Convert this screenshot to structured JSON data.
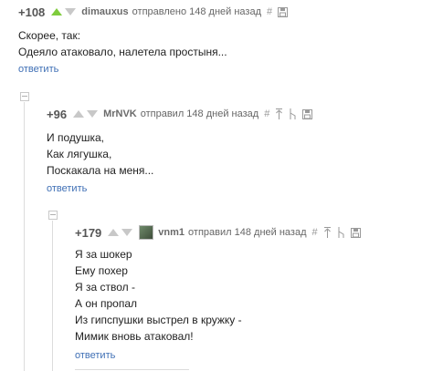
{
  "comments": [
    {
      "rating": "+108",
      "author": "dimauxus",
      "meta": "отправлено 148 дней назад",
      "lines": [
        "Скорее, так:",
        "Одеяло атаковало, налетела простыня..."
      ],
      "reply_label": "ответить",
      "tools": [
        "link-hash-icon",
        "save-icon"
      ]
    },
    {
      "rating": "+96",
      "author": "MrNVK",
      "meta": "отправил 148 дней назад",
      "lines": [
        "И подушка,",
        "Как лягушка,",
        "Поскакала на меня..."
      ],
      "reply_label": "ответить",
      "tools": [
        "link-hash-icon",
        "parent-icon",
        "branch-icon",
        "save-icon"
      ]
    },
    {
      "rating": "+179",
      "author": "vnm1",
      "meta": "отправил 148 дней назад",
      "lines": [
        "Я за шокер",
        "Ему похер",
        "Я за ствол -",
        "А он пропал",
        "Из гипспушки выстрел в кружку -",
        "Мимик вновь атаковал!"
      ],
      "reply_label": "ответить",
      "tools": [
        "link-hash-icon",
        "parent-icon",
        "branch-icon",
        "save-icon"
      ]
    }
  ],
  "colors": {
    "vote_up": "#7fcc3d",
    "vote_down": "#c8c8c8",
    "reply_link": "#3f6fb5"
  },
  "hash_glyph": "#"
}
